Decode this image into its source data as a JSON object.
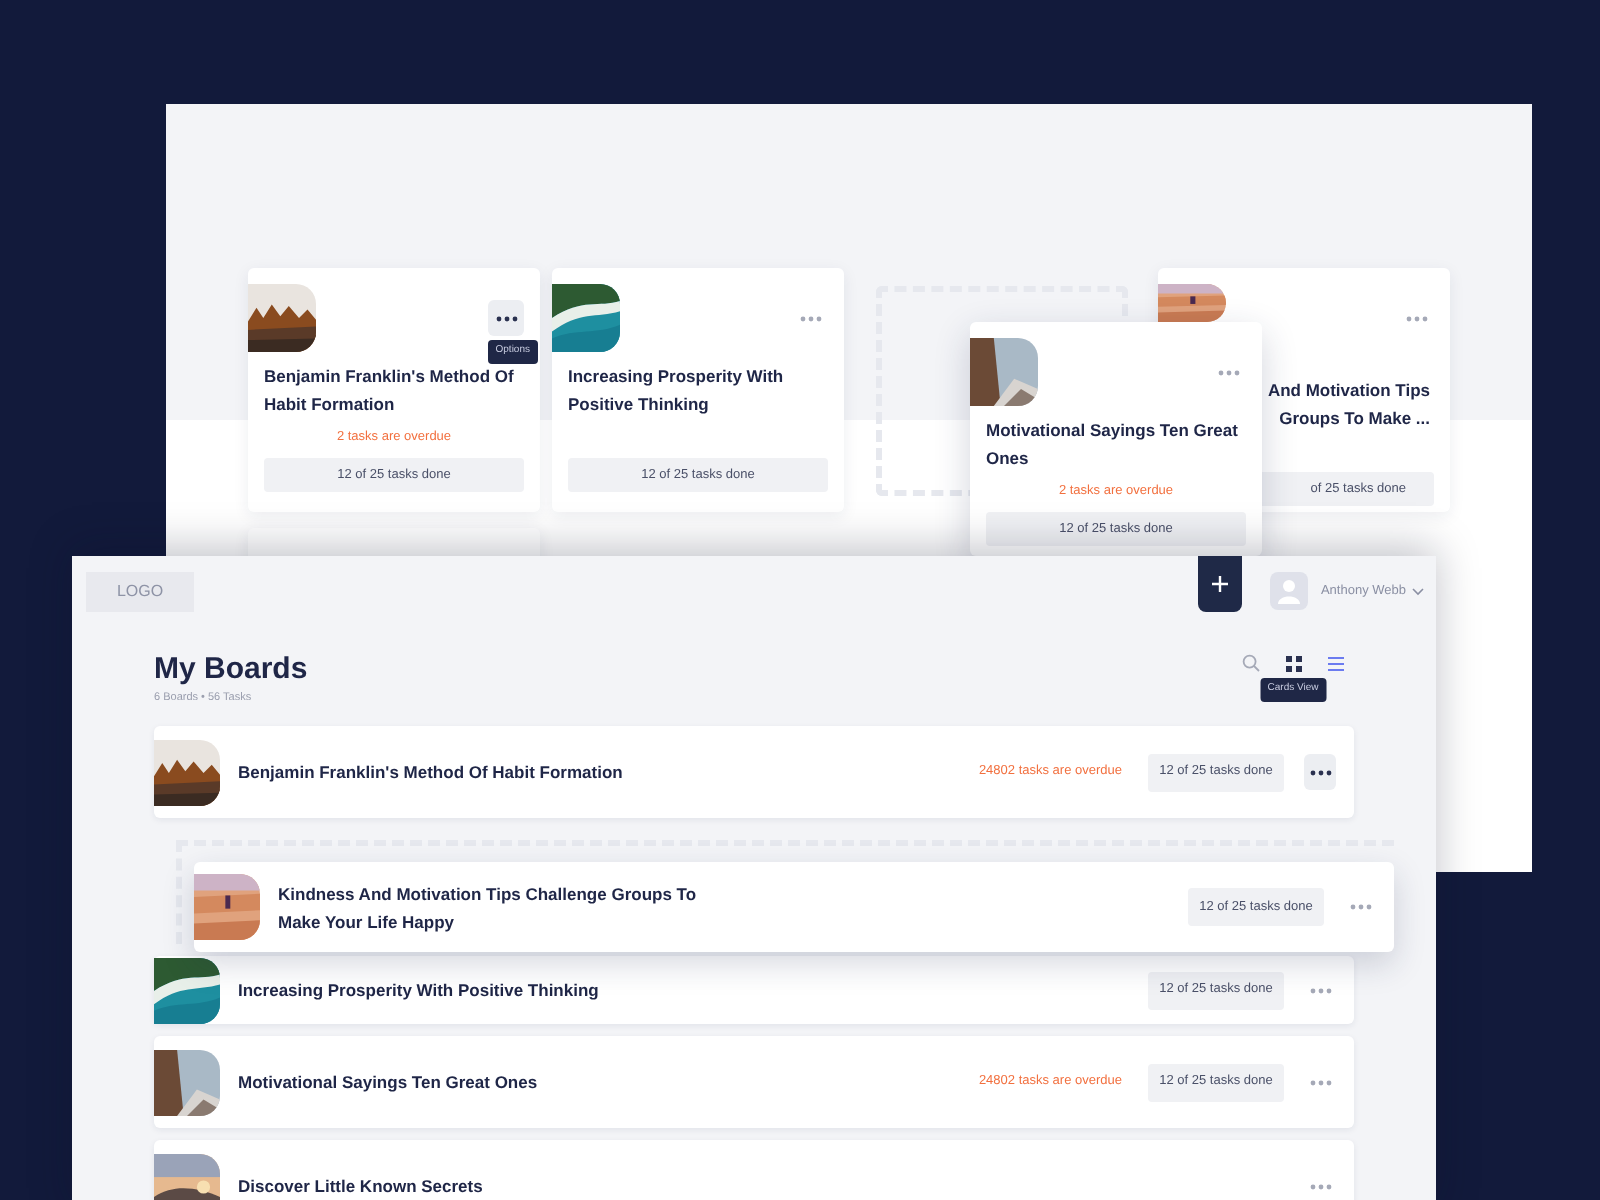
{
  "back_board": {
    "cards": [
      {
        "title": "Benjamin Franklin's Method Of Habit Formation",
        "overdue": "2 tasks are overdue",
        "progress": "12 of 25 tasks done",
        "menu_active": true,
        "tooltip": "Options"
      },
      {
        "title": "Increasing Prosperity With Positive Thinking",
        "progress": "12 of 25 tasks done",
        "menu_active": false
      }
    ],
    "partial_card": {
      "title_lines": [
        "And Motivation Tips",
        "Groups To Make ..."
      ],
      "progress": "of 25 tasks done"
    },
    "dragged_card": {
      "title": "Motivational Sayings Ten Great Ones",
      "overdue": "2 tasks are overdue",
      "progress": "12 of 25 tasks done",
      "menu_active": false
    }
  },
  "front_board": {
    "header": {
      "logo": "LOGO",
      "user_name": "Anthony Webb"
    },
    "title": "My Boards",
    "subtitle": "6 Boards • 56 Tasks",
    "view_buttons": [
      {
        "kind": "search",
        "selected": false
      },
      {
        "kind": "grid",
        "selected": false,
        "tooltip": "Cards View"
      },
      {
        "kind": "list",
        "selected": true
      }
    ],
    "rows": [
      {
        "title": "Benjamin Franklin's Method Of Habit Formation",
        "overdue": "24802 tasks are overdue",
        "progress": "12 of 25 tasks done",
        "menu_active": true
      },
      {
        "title": "Increasing Prosperity With Positive Thinking",
        "progress": "12 of 25 tasks done",
        "menu_active": false
      },
      {
        "title": "Motivational Sayings Ten Great Ones",
        "overdue": "24802 tasks are overdue",
        "progress": "12 of 25 tasks done",
        "menu_active": false
      },
      {
        "title": "Discover Little Known Secrets",
        "menu_active": false
      }
    ],
    "dragged_row": {
      "title": "Kindness And Motivation Tips Challenge Groups To Make Your Life Happy",
      "progress": "12 of 25 tasks done",
      "menu_active": false
    }
  }
}
